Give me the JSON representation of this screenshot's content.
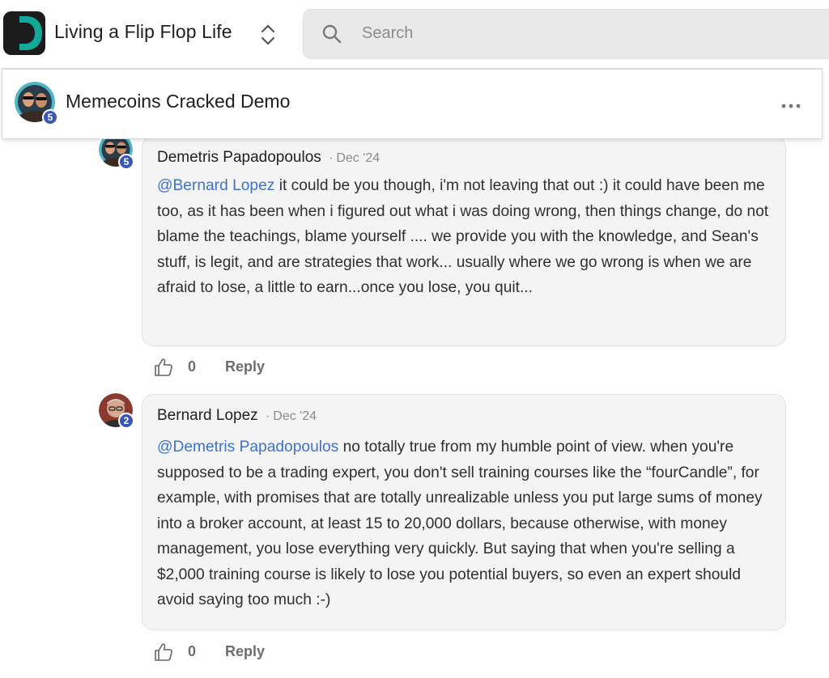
{
  "topbar": {
    "community_name": "Living a Flip Flop Life",
    "search_placeholder": "Search"
  },
  "post": {
    "title": "Memecoins Cracked Demo",
    "author_level": "5"
  },
  "comments": [
    {
      "author": "Demetris Papadopoulos",
      "level": "5",
      "separator": "·",
      "date": "Dec '24",
      "mention": "@Bernard Lopez",
      "text": " it could be you though, i'm not leaving that out :) it could have been me too, as it has been when i figured out what i was doing wrong, then things change, do not blame the teachings, blame yourself .... we provide you with the knowledge, and Sean's stuff, is legit, and are strategies that work... usually where we go wrong is when we are afraid to lose, a little to earn...once you lose, you quit...",
      "likes": "0",
      "reply_label": "Reply"
    },
    {
      "author": "Bernard Lopez",
      "level": "2",
      "separator": "·",
      "date": "Dec '24",
      "mention": "@Demetris Papadopoulos",
      "text": " no totally true from my humble point of view. when you're supposed to be a trading expert, you don't sell training courses like the “fourCandle”, for example, with promises that are totally unrealizable unless you put large sums of money into a broker account, at least 15 to 20,000 dollars, because otherwise, with money management, you lose everything very quickly. But saying that when you're selling a $2,000 training course is likely to lose you potential buyers, so even an expert should avoid saying too much :-)",
      "likes": "0",
      "reply_label": "Reply"
    }
  ],
  "colors": {
    "logo_teal": "#12a89a",
    "mention": "#3e73c9",
    "badge": "#3b57b6"
  },
  "icons": [
    "search-icon",
    "chevron-up-down-icon",
    "more-options-icon",
    "thumbs-up-icon"
  ]
}
